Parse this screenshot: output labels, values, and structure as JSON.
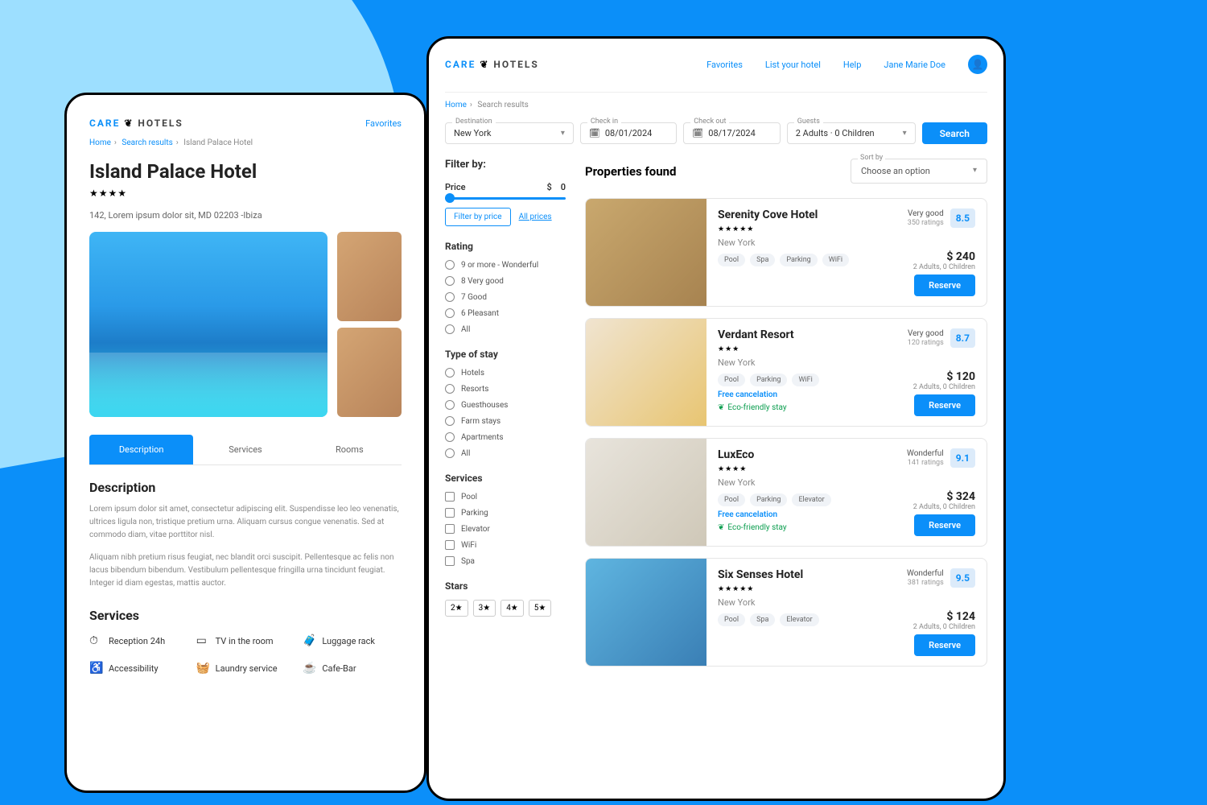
{
  "logo": {
    "brand1": "CARE",
    "brand2": "HOTELS"
  },
  "left": {
    "nav": {
      "favorites": "Favorites"
    },
    "breadcrumb": {
      "home": "Home",
      "search": "Search results",
      "current": "Island Palace Hotel"
    },
    "title": "Island Palace Hotel",
    "stars": "★★★★",
    "address": "142, Lorem ipsum dolor sit, MD 02203 -Ibiza",
    "tabs": {
      "description": "Description",
      "services": "Services",
      "rooms": "Rooms"
    },
    "desc_heading": "Description",
    "desc_p1": "Lorem ipsum dolor sit amet, consectetur adipiscing elit. Suspendisse leo leo venenatis, ultrices ligula non, tristique pretium urna. Aliquam cursus congue venenatis. Sed at commodo diam, vitae porttitor nisl.",
    "desc_p2": "Aliquam nibh pretium risus feugiat, nec blandit orci suscipit. Pellentesque ac felis non lacus bibendum bibendum. Vestibulum pellentesque fringilla urna tincidunt feugiat. Integer id diam egestas, mattis auctor.",
    "svc_heading": "Services",
    "services": [
      {
        "icon": "⏱",
        "label": "Reception 24h"
      },
      {
        "icon": "▭",
        "label": "TV in the room"
      },
      {
        "icon": "🧳",
        "label": "Luggage rack"
      },
      {
        "icon": "♿",
        "label": "Accessibility"
      },
      {
        "icon": "🧺",
        "label": "Laundry service"
      },
      {
        "icon": "☕",
        "label": "Cafe-Bar"
      }
    ]
  },
  "right": {
    "nav": {
      "favorites": "Favorites",
      "list": "List your hotel",
      "help": "Help",
      "user": "Jane Marie Doe"
    },
    "breadcrumb": {
      "home": "Home",
      "current": "Search results"
    },
    "search": {
      "dest_label": "Destination",
      "dest": "New York",
      "in_label": "Check in",
      "in": "08/01/2024",
      "out_label": "Check out",
      "out": "08/17/2024",
      "guests_label": "Guests",
      "guests": "2 Adults  ·  0 Children",
      "button": "Search"
    },
    "filters": {
      "title": "Filter by:",
      "price_label": "Price",
      "currency": "$",
      "price_val": "0",
      "filter_price_btn": "Filter by price",
      "all_prices": "All prices",
      "rating_label": "Rating",
      "rating_opts": [
        "9 or more - Wonderful",
        "8 Very good",
        "7 Good",
        "6 Pleasant",
        "All"
      ],
      "stay_label": "Type of stay",
      "stay_opts": [
        "Hotels",
        "Resorts",
        "Guesthouses",
        "Farm stays",
        "Apartments",
        "All"
      ],
      "services_label": "Services",
      "services_opts": [
        "Pool",
        "Parking",
        "Elevator",
        "WiFi",
        "Spa"
      ],
      "stars_label": "Stars",
      "star_opts": [
        "2★",
        "3★",
        "4★",
        "5★"
      ]
    },
    "results": {
      "title": "Properties found",
      "sort_label": "Sort by",
      "sort_value": "Choose an option",
      "props": [
        {
          "name": "Serenity Cove Hotel",
          "stars": "★★★★★",
          "loc": "New York",
          "tags": [
            "Pool",
            "Spa",
            "Parking",
            "WiFi"
          ],
          "rating_label": "Very good",
          "ratings_count": "350 ratings",
          "score": "8.5",
          "price": "$ 240",
          "guests": "2 Adults, 0 Children",
          "free_cancel": false,
          "eco": false
        },
        {
          "name": "Verdant Resort",
          "stars": "★★★",
          "loc": "New York",
          "tags": [
            "Pool",
            "Parking",
            "WiFi"
          ],
          "rating_label": "Very good",
          "ratings_count": "120 ratings",
          "score": "8.7",
          "price": "$ 120",
          "guests": "2 Adults, 0 Children",
          "free_cancel": true,
          "eco": true
        },
        {
          "name": "LuxEco",
          "stars": "★★★★",
          "loc": "New York",
          "tags": [
            "Pool",
            "Parking",
            "Elevator"
          ],
          "rating_label": "Wonderful",
          "ratings_count": "141 ratings",
          "score": "9.1",
          "price": "$ 324",
          "guests": "2 Adults, 0 Children",
          "free_cancel": true,
          "eco": true
        },
        {
          "name": "Six Senses Hotel",
          "stars": "★★★★★",
          "loc": "New York",
          "tags": [
            "Pool",
            "Spa",
            "Elevator"
          ],
          "rating_label": "Wonderful",
          "ratings_count": "381 ratings",
          "score": "9.5",
          "price": "$ 124",
          "guests": "2 Adults, 0 Children",
          "free_cancel": false,
          "eco": false
        }
      ],
      "reserve": "Reserve",
      "free_cancel_text": "Free cancelation",
      "eco_text": "Eco-friendly stay"
    }
  }
}
